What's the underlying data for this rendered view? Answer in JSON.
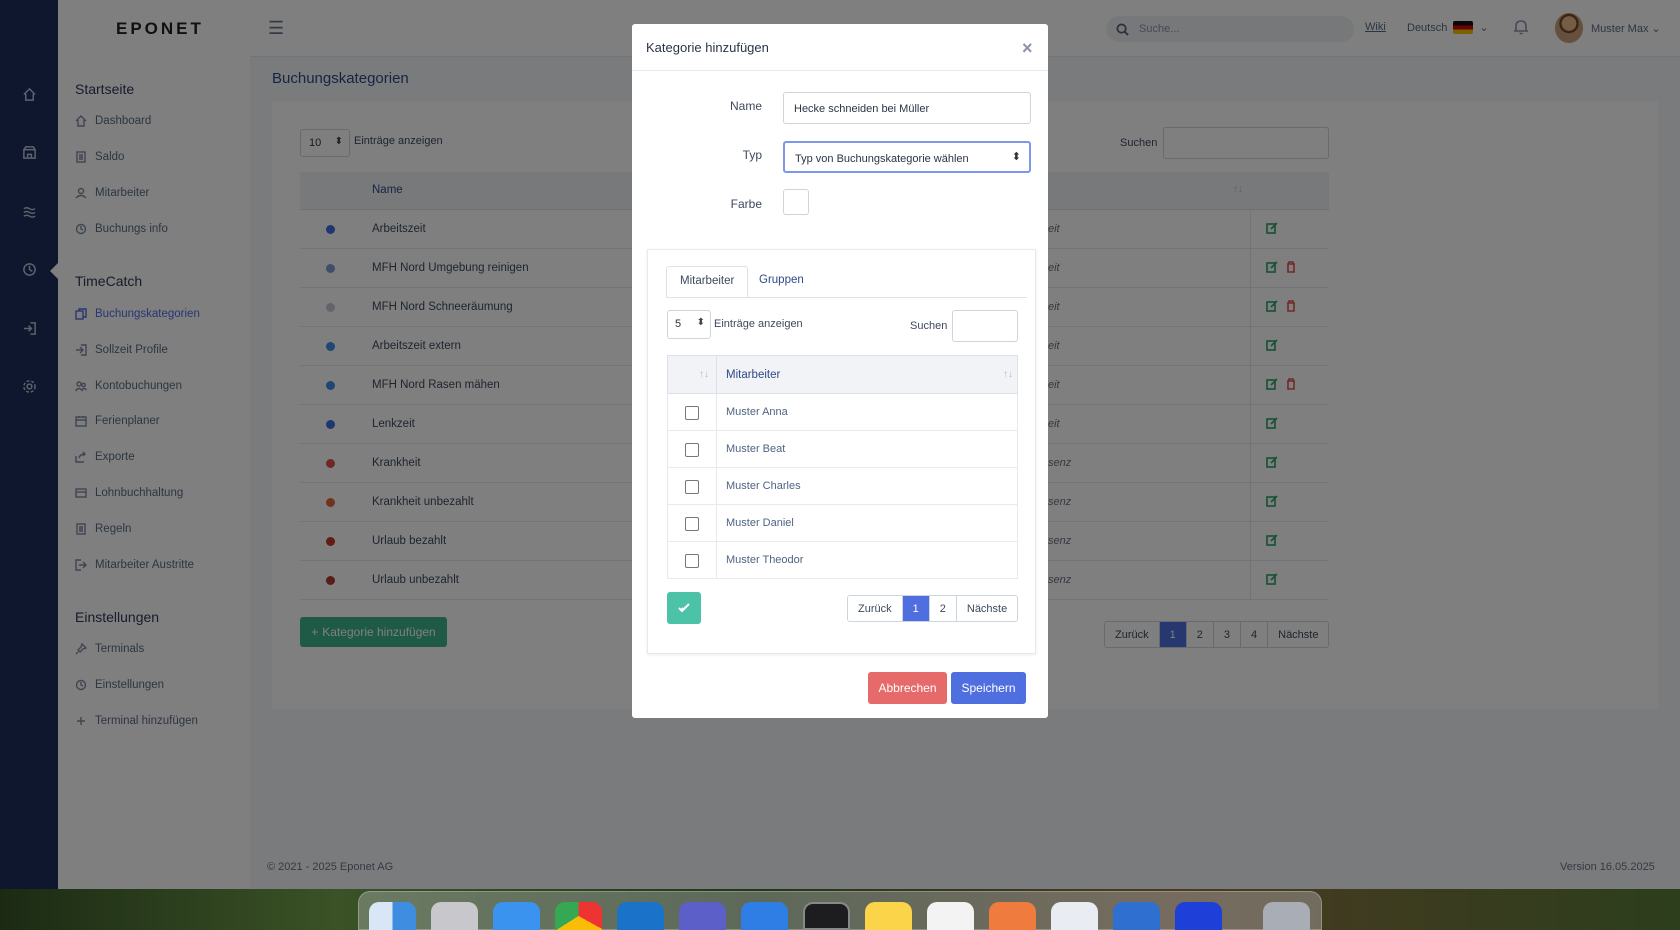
{
  "app": {
    "logo": "EPONET",
    "search_placeholder": "Suche...",
    "wiki": "Wiki",
    "language": "Deutsch",
    "user": "Muster Max"
  },
  "sidebar": {
    "section1": "Startseite",
    "items1": [
      {
        "label": "Dashboard",
        "icon": "home-icon"
      },
      {
        "label": "Saldo",
        "icon": "document-icon"
      },
      {
        "label": "Mitarbeiter",
        "icon": "user-icon"
      },
      {
        "label": "Buchungs info",
        "icon": "history-icon"
      }
    ],
    "section2": "TimeCatch",
    "items2": [
      {
        "label": "Buchungskategorien",
        "icon": "copy-icon",
        "active": true
      },
      {
        "label": "Sollzeit Profile",
        "icon": "login-icon"
      },
      {
        "label": "Kontobuchungen",
        "icon": "users-icon"
      },
      {
        "label": "Ferienplaner",
        "icon": "calendar-icon"
      },
      {
        "label": "Exporte",
        "icon": "share-icon"
      },
      {
        "label": "Lohnbuchhaltung",
        "icon": "wallet-icon"
      },
      {
        "label": "Regeln",
        "icon": "document-icon"
      },
      {
        "label": "Mitarbeiter Austritte",
        "icon": "logout-icon"
      }
    ],
    "section3": "Einstellungen",
    "items3": [
      {
        "label": "Terminals",
        "icon": "pin-icon"
      },
      {
        "label": "Einstellungen",
        "icon": "clock-icon"
      },
      {
        "label": "Terminal hinzufügen",
        "icon": "plus-icon"
      }
    ]
  },
  "page": {
    "title": "Buchungskategorien",
    "length_value": "10",
    "length_label": "Einträge anzeigen",
    "search_label": "Suchen",
    "column_name": "Name",
    "rows": [
      {
        "name": "Arbeitszeit",
        "type": "eit",
        "color": "#3b6fe0",
        "deletable": false
      },
      {
        "name": "MFH Nord Umgebung reinigen",
        "type": "eit",
        "color": "#7f9bd6",
        "deletable": true
      },
      {
        "name": "MFH Nord Schneeräumung",
        "type": "eit",
        "color": "#c3cad6",
        "deletable": true
      },
      {
        "name": "Arbeitszeit extern",
        "type": "eit",
        "color": "#3a8ee8",
        "deletable": false
      },
      {
        "name": "MFH Nord Rasen mähen",
        "type": "eit",
        "color": "#3a8ee8",
        "deletable": true
      },
      {
        "name": "Lenkzeit",
        "type": "eit",
        "color": "#3b6fe0",
        "deletable": false
      },
      {
        "name": "Krankheit",
        "type": "senz",
        "color": "#d9534f",
        "deletable": false
      },
      {
        "name": "Krankheit unbezahlt",
        "type": "senz",
        "color": "#e2673f",
        "deletable": false
      },
      {
        "name": "Urlaub bezahlt",
        "type": "senz",
        "color": "#c0392b",
        "deletable": false
      },
      {
        "name": "Urlaub unbezahlt",
        "type": "senz",
        "color": "#b03a2e",
        "deletable": false
      }
    ],
    "add_button": "Kategorie hinzufügen",
    "pager": [
      "Zurück",
      "1",
      "2",
      "3",
      "4",
      "Nächste"
    ],
    "pager_active": "1"
  },
  "footer": {
    "copyright": "© 2021 - 2025 Eponet AG",
    "version": "Version  16.05.2025"
  },
  "modal": {
    "title": "Kategorie hinzufügen",
    "close": "×",
    "name_label": "Name",
    "name_value": "Hecke schneiden bei Müller",
    "type_label": "Typ",
    "type_value": "Typ von Buchungskategorie wählen",
    "color_label": "Farbe",
    "tabs": [
      "Mitarbeiter",
      "Gruppen"
    ],
    "length_value": "5",
    "length_label": "Einträge anzeigen",
    "search_label": "Suchen",
    "column": "Mitarbeiter",
    "employees": [
      "Muster Anna",
      "Muster Beat",
      "Muster Charles",
      "Muster Daniel",
      "Muster Theodor"
    ],
    "pager": [
      "Zurück",
      "1",
      "2",
      "Nächste"
    ],
    "pager_active": "1",
    "cancel": "Abbrechen",
    "save": "Speichern"
  }
}
